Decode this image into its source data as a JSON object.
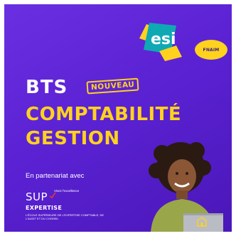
{
  "logos": {
    "esi": "esi",
    "fnaim": "FNAIM"
  },
  "headline": {
    "bts": "BTS",
    "badge": "NOUVEAU",
    "title_line_1": "COMPTABILITÉ",
    "title_line_2": "GESTION"
  },
  "partnership": {
    "intro": "En partenariat avec",
    "sup_word": "SUP",
    "tagline": "Vivez l'excellence",
    "expertise": "EXPERTISE",
    "description": "L'école supérieure de l'expertise comptable, de l'audit et du conseil"
  },
  "colors": {
    "background": "#5b22d4",
    "accent_yellow": "#ffd21e",
    "esi_teal": "#0fa9b4",
    "text_white": "#ffffff"
  }
}
